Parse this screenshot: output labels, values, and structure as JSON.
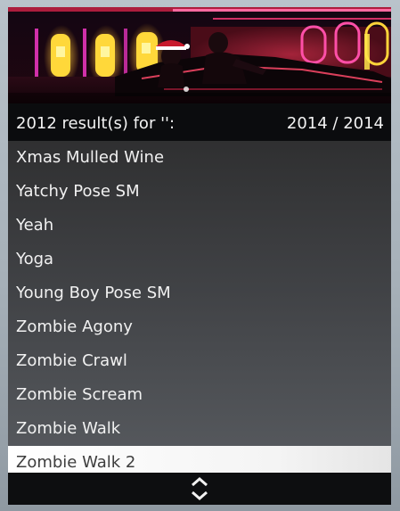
{
  "header": {
    "results_text": "2012 result(s) for '':",
    "counter": "2014 / 2014"
  },
  "list": {
    "items": [
      {
        "label": "Xmas Mulled Wine"
      },
      {
        "label": "Yatchy Pose SM"
      },
      {
        "label": "Yeah"
      },
      {
        "label": "Yoga"
      },
      {
        "label": "Young Boy Pose SM"
      },
      {
        "label": "Zombie Agony"
      },
      {
        "label": "Zombie Crawl"
      },
      {
        "label": "Zombie Scream"
      },
      {
        "label": "Zombie Walk"
      },
      {
        "label": "Zombie Walk 2"
      }
    ],
    "selected_index": 9
  },
  "footer": {
    "icon": "up-down-arrows-icon"
  },
  "colors": {
    "subheader_bg": "#0b0c0e",
    "selected_bg": "#ffffff",
    "selected_text": "#3e3e3e",
    "item_text": "#f1f1f1",
    "neon_red": "#ff2a55",
    "neon_yellow": "#ffe54a"
  }
}
